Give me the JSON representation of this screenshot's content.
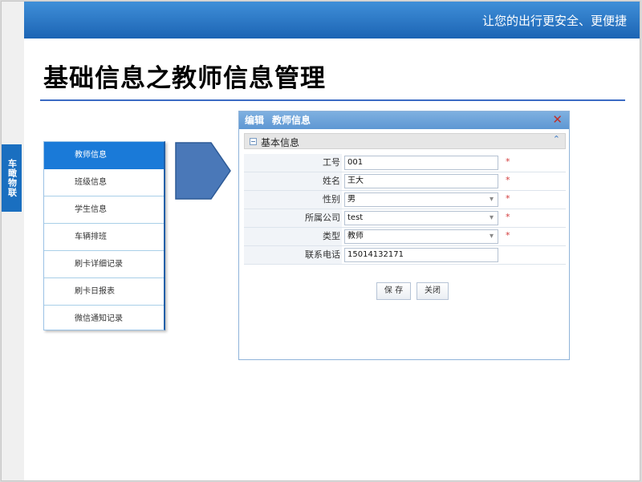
{
  "header": {
    "slogan": "让您的出行更安全、更便捷",
    "brand_tab": "车瞰物联"
  },
  "page": {
    "title": "基础信息之教师信息管理"
  },
  "nav": {
    "items": [
      {
        "label": "教师信息",
        "active": true
      },
      {
        "label": "班级信息",
        "active": false
      },
      {
        "label": "学生信息",
        "active": false
      },
      {
        "label": "车辆排班",
        "active": false
      },
      {
        "label": "刷卡详细记录",
        "active": false
      },
      {
        "label": "刷卡日报表",
        "active": false
      },
      {
        "label": "微信通知记录",
        "active": false
      }
    ]
  },
  "dialog": {
    "title_action": "编辑",
    "title_entity": "教师信息",
    "section_title": "基本信息",
    "fields": [
      {
        "label": "工号",
        "value": "001",
        "required": true,
        "type": "text"
      },
      {
        "label": "姓名",
        "value": "王大",
        "required": true,
        "type": "text"
      },
      {
        "label": "性别",
        "value": "男",
        "required": true,
        "type": "select"
      },
      {
        "label": "所属公司",
        "value": "test",
        "required": true,
        "type": "select"
      },
      {
        "label": "类型",
        "value": "教师",
        "required": true,
        "type": "select"
      },
      {
        "label": "联系电话",
        "value": "15014132171",
        "required": false,
        "type": "text"
      }
    ],
    "save_label": "保 存",
    "close_label": "关闭",
    "required_mark": "*",
    "close_icon": "✕",
    "collapse_icon": "⌃"
  },
  "colors": {
    "banner": "#1c64b4",
    "accent": "#1a7ad8",
    "required": "#d23a3a"
  }
}
